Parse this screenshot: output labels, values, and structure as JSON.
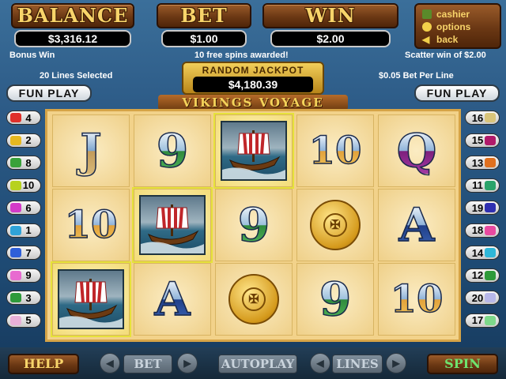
{
  "header": {
    "balance_title": "BALANCE",
    "balance_value": "$3,316.12",
    "bet_title": "BET",
    "bet_value": "$1.00",
    "win_title": "WIN",
    "win_value": "$2.00"
  },
  "menu": {
    "items": [
      {
        "label": "cashier",
        "icon": "cashier-icon"
      },
      {
        "label": "options",
        "icon": "options-icon"
      },
      {
        "label": "back",
        "icon": "back-arrow-icon"
      }
    ]
  },
  "messages": {
    "bonus_win": "Bonus Win",
    "free_spins": "10 free spins awarded!",
    "scatter_win": "Scatter win of $2.00",
    "lines_selected": "20 Lines Selected",
    "bet_per_line": "$0.05 Bet Per Line"
  },
  "jackpot": {
    "label": "RANDOM JACKPOT",
    "value": "$4,180.39"
  },
  "fun_play": "FUN PLAY",
  "game_title": "VIKINGS VOYAGE",
  "reels": [
    [
      "J",
      "10",
      "ship"
    ],
    [
      "9",
      "ship",
      "A"
    ],
    [
      "ship",
      "9",
      "coin"
    ],
    [
      "10",
      "coin",
      "9"
    ],
    [
      "Q",
      "A",
      "10"
    ]
  ],
  "winning_cells": [
    [
      0,
      2
    ],
    [
      1,
      1
    ],
    [
      2,
      0
    ]
  ],
  "coin_text": "PECIT",
  "lines_left": [
    {
      "num": "4",
      "color": "#e0302a"
    },
    {
      "num": "2",
      "color": "#e6b81f"
    },
    {
      "num": "8",
      "color": "#3aa23a"
    },
    {
      "num": "10",
      "color": "#b7d21e"
    },
    {
      "num": "6",
      "color": "#d43ac8"
    },
    {
      "num": "1",
      "color": "#2fa3d8"
    },
    {
      "num": "7",
      "color": "#2f5fd8"
    },
    {
      "num": "9",
      "color": "#e86ad0"
    },
    {
      "num": "3",
      "color": "#2e9a3a"
    },
    {
      "num": "5",
      "color": "#e8b0d8"
    }
  ],
  "lines_right": [
    {
      "num": "16",
      "color": "#d9c47a"
    },
    {
      "num": "15",
      "color": "#b01a6a"
    },
    {
      "num": "13",
      "color": "#e0701e"
    },
    {
      "num": "11",
      "color": "#2aa36a"
    },
    {
      "num": "19",
      "color": "#2f2fb0"
    },
    {
      "num": "18",
      "color": "#e84aa0"
    },
    {
      "num": "14",
      "color": "#2fb7d8"
    },
    {
      "num": "12",
      "color": "#2e9a3a"
    },
    {
      "num": "20",
      "color": "#b7b7e8"
    },
    {
      "num": "17",
      "color": "#7dd88a"
    }
  ],
  "controls": {
    "help": "HELP",
    "bet": "BET",
    "autoplay": "AUTOPLAY",
    "lines": "LINES",
    "spin": "SPIN",
    "minus": "◀",
    "plus": "▶"
  }
}
